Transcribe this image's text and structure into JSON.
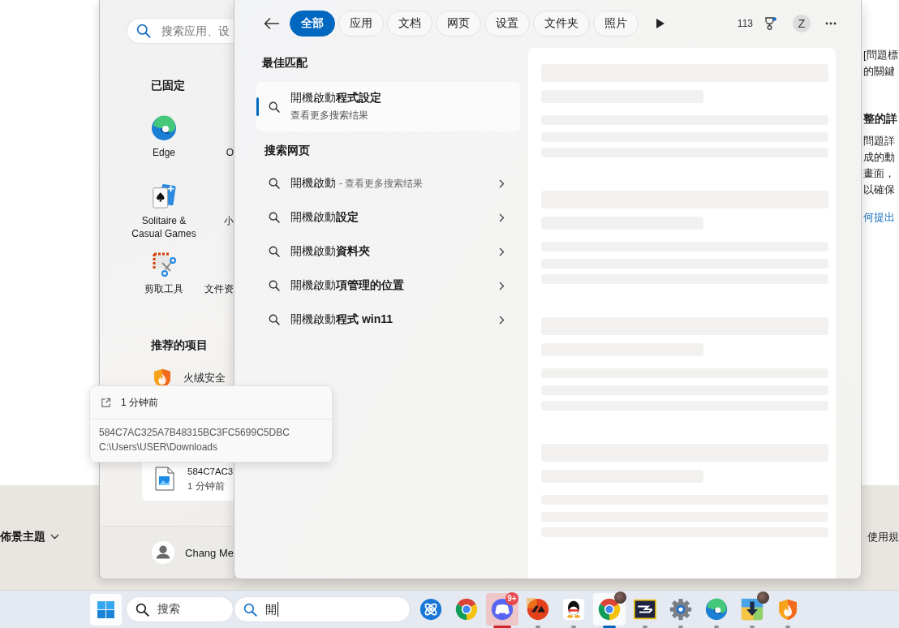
{
  "web_page": {
    "right_column": [
      {
        "kind": "paragraph",
        "lines": [
          "[問題標",
          "的關鍵"
        ]
      },
      {
        "kind": "heading",
        "text": "整的詳"
      },
      {
        "kind": "paragraph",
        "lines": [
          "問題詳",
          "成的動",
          "畫面，",
          "以確保"
        ]
      },
      {
        "kind": "link",
        "text": "何提出"
      }
    ],
    "footer": {
      "theme_menu": "佈景主題",
      "terms_link": "使用規"
    }
  },
  "start_menu": {
    "search_placeholder": "搜索应用、设",
    "pinned_title": "已固定",
    "pinned": [
      {
        "kind": "browser",
        "label": "Edge"
      },
      {
        "kind": "clipped",
        "label": "O"
      },
      {
        "kind": "cards",
        "label": "Solitaire & Casual Games"
      },
      {
        "kind": "clipped",
        "label": "小"
      },
      {
        "kind": "scissors",
        "label": "剪取工具"
      },
      {
        "kind": "clipped",
        "label": "文件资"
      }
    ],
    "recommended_title": "推荐的项目",
    "recommended": [
      {
        "kind": "shield",
        "title": "火绒安全",
        "selected": false
      },
      {
        "kind": "image_file",
        "title": "584C7AC3",
        "subtitle": "1 分钟前",
        "selected": true
      }
    ],
    "user": {
      "name": "Chang Me"
    }
  },
  "search": {
    "tabs": [
      {
        "label": "全部",
        "selected": true
      },
      {
        "label": "应用",
        "selected": false
      },
      {
        "label": "文档",
        "selected": false
      },
      {
        "label": "网页",
        "selected": false
      },
      {
        "label": "设置",
        "selected": false
      },
      {
        "label": "文件夹",
        "selected": false
      },
      {
        "label": "照片",
        "selected": false
      }
    ],
    "points": "113",
    "rewards_unread": true,
    "avatar_initial": "Z",
    "best_match_title": "最佳匹配",
    "best_match": {
      "title": "開機啟動**程式設定**",
      "subtitle": "查看更多搜索结果",
      "selected": true
    },
    "web_title": "搜索网页",
    "web_results": [
      {
        "text": "開機啟動",
        "hint": "- 查看更多搜索结果"
      },
      {
        "text": "開機啟動**設定**"
      },
      {
        "text": "開機啟動**資料夾**"
      },
      {
        "text": "開機啟動**項管理的位置**"
      },
      {
        "text": "開機啟動**程式 win11**"
      }
    ],
    "preview": {
      "loading": true
    }
  },
  "tooltip": {
    "time": "1 分钟前",
    "name": "584C7AC325A7B48315BC3FC5699C5DBC",
    "path": "C:\\Users\\USER\\Downloads"
  },
  "taskbar": {
    "search_placeholder": "搜索",
    "query": "開",
    "apps": [
      {
        "kind": "orbit",
        "running": false,
        "active": false,
        "attention": false
      },
      {
        "kind": "chrome",
        "running": false,
        "active": false,
        "attention": false
      },
      {
        "kind": "chat",
        "running": true,
        "active": false,
        "attention": true,
        "badge": "9+"
      },
      {
        "kind": "ea",
        "running": true,
        "active": false,
        "attention": false
      },
      {
        "kind": "penguin",
        "running": true,
        "active": false,
        "attention": false
      },
      {
        "kind": "chrome",
        "running": true,
        "active": true,
        "attention": false,
        "profile_badge": true
      },
      {
        "kind": "game",
        "running": true,
        "active": false,
        "attention": false
      },
      {
        "kind": "settings",
        "running": true,
        "active": false,
        "attention": false
      },
      {
        "kind": "edge",
        "running": true,
        "active": false,
        "attention": false
      },
      {
        "kind": "download",
        "running": true,
        "active": false,
        "attention": false,
        "profile_badge": true
      },
      {
        "kind": "shield",
        "running": true,
        "active": false,
        "attention": false
      }
    ]
  }
}
